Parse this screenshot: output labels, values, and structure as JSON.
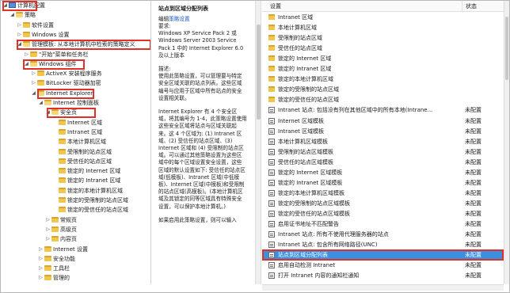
{
  "tree": {
    "items": [
      {
        "label": "计算机配置",
        "indent": 0,
        "icon": "pc"
      },
      {
        "label": "策略",
        "indent": 1,
        "icon": "folder"
      },
      {
        "label": "软件设置",
        "indent": 2,
        "icon": "folder"
      },
      {
        "label": "Windows 设置",
        "indent": 2,
        "icon": "folder"
      },
      {
        "label": "管理模板: 从本地计算机中检索的策略定义",
        "indent": 2,
        "icon": "folder"
      },
      {
        "label": "\"开始\"菜单和任务栏",
        "indent": 3,
        "icon": "folder"
      },
      {
        "label": "Windows 组件",
        "indent": 3,
        "icon": "folder"
      },
      {
        "label": "ActiveX 安装程序服务",
        "indent": 4,
        "icon": "folder"
      },
      {
        "label": "BitLocker 驱动器加密",
        "indent": 4,
        "icon": "folder"
      },
      {
        "label": "Internet Explorer",
        "indent": 4,
        "icon": "folder"
      },
      {
        "label": "Internet 控制面板",
        "indent": 5,
        "icon": "folder"
      },
      {
        "label": "安全页",
        "indent": 6,
        "icon": "folder"
      },
      {
        "label": "Internet 区域",
        "indent": 7,
        "icon": "folder"
      },
      {
        "label": "Intranet 区域",
        "indent": 7,
        "icon": "folder"
      },
      {
        "label": "本地计算机区域",
        "indent": 7,
        "icon": "folder"
      },
      {
        "label": "受限制的站点区域",
        "indent": 7,
        "icon": "folder"
      },
      {
        "label": "受信任的站点区域",
        "indent": 7,
        "icon": "folder"
      },
      {
        "label": "锁定的 Internet 区域",
        "indent": 7,
        "icon": "folder"
      },
      {
        "label": "锁定的 Intranet 区域",
        "indent": 7,
        "icon": "folder"
      },
      {
        "label": "锁定的本地计算机区域",
        "indent": 7,
        "icon": "folder"
      },
      {
        "label": "锁定的受限制的站点区域",
        "indent": 7,
        "icon": "folder"
      },
      {
        "label": "锁定的受信任的站点区域",
        "indent": 7,
        "icon": "folder"
      },
      {
        "label": "常规页",
        "indent": 6,
        "icon": "folder"
      },
      {
        "label": "高级页",
        "indent": 6,
        "icon": "folder"
      },
      {
        "label": "内容页",
        "indent": 6,
        "icon": "folder"
      },
      {
        "label": "Internet 设置",
        "indent": 5,
        "icon": "folder"
      },
      {
        "label": "安全功能",
        "indent": 5,
        "icon": "folder"
      },
      {
        "label": "工具栏",
        "indent": 5,
        "icon": "folder"
      },
      {
        "label": "管理的",
        "indent": 5,
        "icon": "folder"
      }
    ]
  },
  "description": {
    "title": "站点到区域分配列表",
    "edit_prefix": "编辑",
    "edit_link": "策略设置",
    "requirement": "要求:\nWindows XP Service Pack 2 或 Windows Server 2003 Service Pack 1 中的 Internet Explorer 6.0 及以上版本",
    "text1": "描述:\n使用此策略设置，可以管理要与特定安全区域关联的站点列表。这些区域编号与应用于区域中所有站点的安全设置相关联。",
    "text2": "Internet Explorer 有 4 个安全区域，将其编号为 1-4，此策略设置使用这些安全区域将站点与区域关联起来。这 4 个区域为: (1) Intranet 区域、(2) 受信任的站点区域、(3) Internet 区域和 (4) 受限制的站点区域。可以通过其他策略设置为这些区域中的每个区域设置安全设置，这些区域的默认设置如下: 受信任的站点区域(低模板)、Intranet 区域(中低模板)、Internet 区域(中模板)和受限制的站点区域(高模板)。(本地计算机区域及其锁定的同等区域具有特殊安全设置，可以保护本地计算机。)",
    "text3": "如果启用此策略设置，则可以输入"
  },
  "list": {
    "col_setting": "设置",
    "col_state": "状态",
    "rows": [
      {
        "label": "Intranet 区域",
        "type": "folder",
        "state": ""
      },
      {
        "label": "本地计算机区域",
        "type": "folder",
        "state": ""
      },
      {
        "label": "受限制的站点区域",
        "type": "folder",
        "state": ""
      },
      {
        "label": "受信任的站点区域",
        "type": "folder",
        "state": ""
      },
      {
        "label": "锁定的 Internet 区域",
        "type": "folder",
        "state": ""
      },
      {
        "label": "锁定的 Intranet 区域",
        "type": "folder",
        "state": ""
      },
      {
        "label": "锁定的本地计算机区域",
        "type": "folder",
        "state": ""
      },
      {
        "label": "锁定的受限制的站点区域",
        "type": "folder",
        "state": ""
      },
      {
        "label": "锁定的受信任的站点区域",
        "type": "folder",
        "state": ""
      },
      {
        "label": "Intranet 站点: 包括没有列在其他区域中的所有本地(Intrane...",
        "type": "setting",
        "state": "未配置"
      },
      {
        "label": "Internet 区域模板",
        "type": "setting",
        "state": "未配置"
      },
      {
        "label": "Intranet 区域模板",
        "type": "setting",
        "state": "未配置"
      },
      {
        "label": "本地计算机区域模板",
        "type": "setting",
        "state": "未配置"
      },
      {
        "label": "受限制的站点区域模板",
        "type": "setting",
        "state": "未配置"
      },
      {
        "label": "受信任的站点区域模板",
        "type": "setting",
        "state": "未配置"
      },
      {
        "label": "锁定的 Internet 区域模板",
        "type": "setting",
        "state": "未配置"
      },
      {
        "label": "锁定的 Intranet 区域模板",
        "type": "setting",
        "state": "未配置"
      },
      {
        "label": "锁定的本地计算机区域模板",
        "type": "setting",
        "state": "未配置"
      },
      {
        "label": "锁定的受限制的站点区域模板",
        "type": "setting",
        "state": "未配置"
      },
      {
        "label": "锁定的受信任的站点区域模板",
        "type": "setting",
        "state": "未配置"
      },
      {
        "label": "启用证书地址不匹配警告",
        "type": "setting",
        "state": "未配置"
      },
      {
        "label": "Intranet 站点: 所有不使用代理服务器的站点",
        "type": "setting",
        "state": "未配置"
      },
      {
        "label": "Intranet 站点: 包含所有网络路径(UNC)",
        "type": "setting",
        "state": "未配置"
      },
      {
        "label": "站点到区域分配列表",
        "type": "setting",
        "state": "未配置",
        "selected": true
      },
      {
        "label": "启用自动检测 Intranet",
        "type": "setting",
        "state": "未配置"
      },
      {
        "label": "打开 Intranet 内容的通知栏通知",
        "type": "setting",
        "state": "未配置"
      }
    ]
  },
  "colors": {
    "highlight": "#e0302a",
    "selection": "#3b8fe0"
  }
}
